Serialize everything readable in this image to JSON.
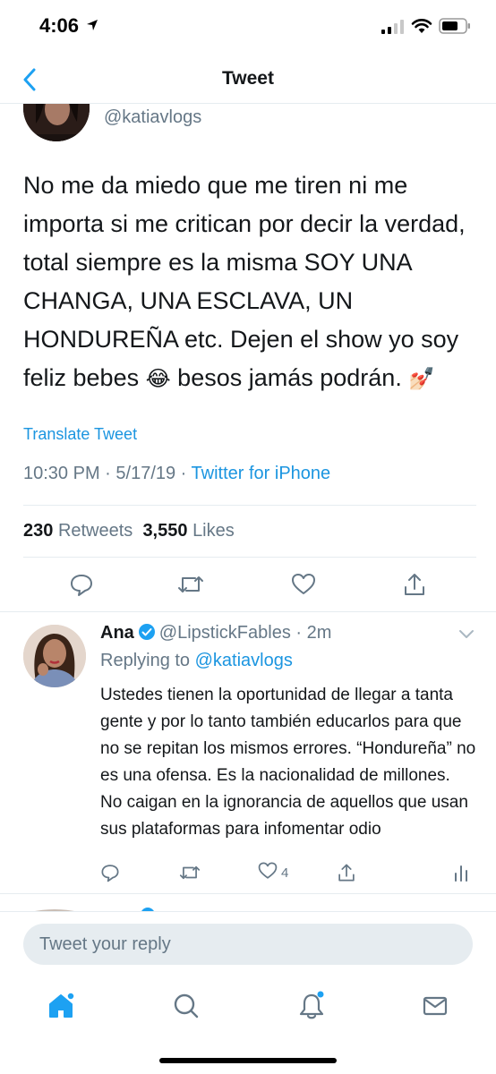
{
  "status_bar": {
    "time": "4:06"
  },
  "nav": {
    "title": "Tweet"
  },
  "tweet": {
    "handle": "@katiavlogs",
    "text_1": "No me da miedo que me tiren ni me importa si me critican por decir la verdad, total siempre es la misma SOY UNA CHANGA, UNA ESCLAVA, UN HONDUREÑA etc. Dejen el show yo soy feliz bebes",
    "emoji_1": "😂",
    "text_2": "besos jamás podrán.",
    "emoji_2": "💅🏻",
    "translate_label": "Translate Tweet",
    "time": "10:30 PM",
    "date": "5/17/19",
    "source": "Twitter for iPhone",
    "retweets_count": "230",
    "retweets_label": "Retweets",
    "likes_count": "3,550",
    "likes_label": "Likes"
  },
  "reply": {
    "name": "Ana",
    "handle": "@LipstickFables",
    "time": "2m",
    "replying_label": "Replying to",
    "replying_to": "@katiavlogs",
    "text": "Ustedes tienen la oportunidad de llegar a tanta gente y por lo tanto también educarlos para que no se repitan los mismos errores. “Hondureña” no es una ofensa. Es la nacionalidad de millones. No caigan en la ignorancia de aquellos que usan sus plataformas para infomentar odio",
    "likes": "4"
  },
  "composer": {
    "placeholder": "Tweet your reply"
  },
  "colors": {
    "accent": "#1da1f2",
    "link": "#1b95e0",
    "muted": "#657786",
    "text": "#14171a",
    "divider": "#e6ecf0"
  },
  "icons": {
    "status": [
      "location-arrow-icon",
      "signal-icon",
      "wifi-icon",
      "battery-icon"
    ],
    "tweet_actions": [
      "reply-icon",
      "retweet-icon",
      "like-icon",
      "share-icon"
    ],
    "reply_actions": [
      "reply-icon",
      "retweet-icon",
      "like-icon",
      "share-icon",
      "analytics-icon"
    ],
    "tabs": [
      "home-icon",
      "search-icon",
      "notifications-icon",
      "messages-icon"
    ]
  }
}
